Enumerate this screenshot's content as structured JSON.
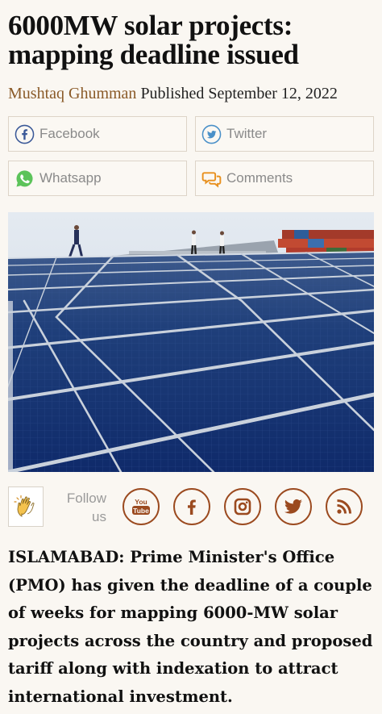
{
  "article": {
    "headline": "6000MW solar projects: mapping deadline issued",
    "author": "Mushtaq Ghumman",
    "published": "Published September 12, 2022",
    "body": "ISLAMABAD: Prime Minister's Office (PMO) has given the deadline of a couple of weeks for mapping 6000-MW solar projects across the country and proposed tariff along with indexation to attract international investment."
  },
  "share": {
    "facebook": "Facebook",
    "twitter": "Twitter",
    "whatsapp": "Whatsapp",
    "comments": "Comments"
  },
  "follow": {
    "label": "Follow us",
    "icons": [
      "youtube-icon",
      "facebook-icon",
      "instagram-icon",
      "twitter-icon",
      "rss-icon"
    ]
  },
  "colors": {
    "accent": "#9b4a1f",
    "author": "#8a5a28",
    "background": "#faf7f2"
  }
}
